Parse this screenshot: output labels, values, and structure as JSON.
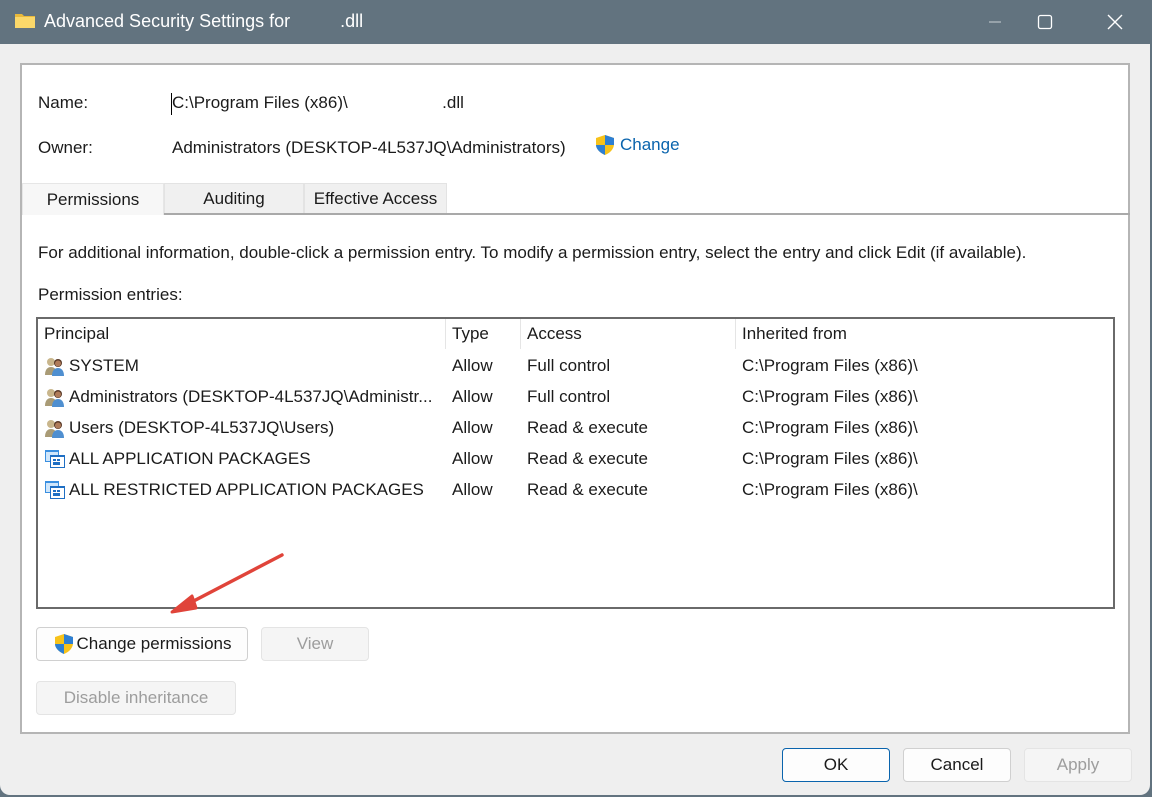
{
  "window": {
    "title": "Advanced Security Settings for          .dll",
    "controls": {
      "minimize": "minimize",
      "maximize": "maximize",
      "close": "close"
    }
  },
  "header": {
    "name_label": "Name:",
    "name_value": "C:\\Program Files (x86)\\                    .dll",
    "owner_label": "Owner:",
    "owner_value": "Administrators (DESKTOP-4L537JQ\\Administrators)",
    "owner_change_link": "Change"
  },
  "tabs": [
    {
      "label": "Permissions",
      "active": true
    },
    {
      "label": "Auditing",
      "active": false
    },
    {
      "label": "Effective Access",
      "active": false
    }
  ],
  "permissions": {
    "info_text": "For additional information, double-click a permission entry. To modify a permission entry, select the entry and click Edit (if available).",
    "entries_label": "Permission entries:",
    "columns": [
      "Principal",
      "Type",
      "Access",
      "Inherited from"
    ],
    "rows": [
      {
        "icon": "user-group-icon",
        "principal": "SYSTEM",
        "type": "Allow",
        "access": "Full control",
        "inherited_from": "C:\\Program Files (x86)\\"
      },
      {
        "icon": "user-group-icon",
        "principal": "Administrators (DESKTOP-4L537JQ\\Administr...",
        "type": "Allow",
        "access": "Full control",
        "inherited_from": "C:\\Program Files (x86)\\"
      },
      {
        "icon": "user-group-icon",
        "principal": "Users (DESKTOP-4L537JQ\\Users)",
        "type": "Allow",
        "access": "Read & execute",
        "inherited_from": "C:\\Program Files (x86)\\"
      },
      {
        "icon": "app-packages-icon",
        "principal": "ALL APPLICATION PACKAGES",
        "type": "Allow",
        "access": "Read & execute",
        "inherited_from": "C:\\Program Files (x86)\\"
      },
      {
        "icon": "app-packages-icon",
        "principal": "ALL RESTRICTED APPLICATION PACKAGES",
        "type": "Allow",
        "access": "Read & execute",
        "inherited_from": "C:\\Program Files (x86)\\"
      }
    ],
    "buttons": {
      "change_permissions": "Change permissions",
      "view": "View",
      "disable_inheritance": "Disable inheritance"
    }
  },
  "footer": {
    "ok": "OK",
    "cancel": "Cancel",
    "apply": "Apply"
  },
  "annotation": {
    "type": "arrow",
    "color": "#e0443a",
    "points_to": "Change permissions"
  },
  "colors": {
    "titlebar": "#62737f",
    "link": "#0a64ad",
    "shield_blue": "#2d7fd3",
    "shield_yellow": "#f7c21a"
  }
}
